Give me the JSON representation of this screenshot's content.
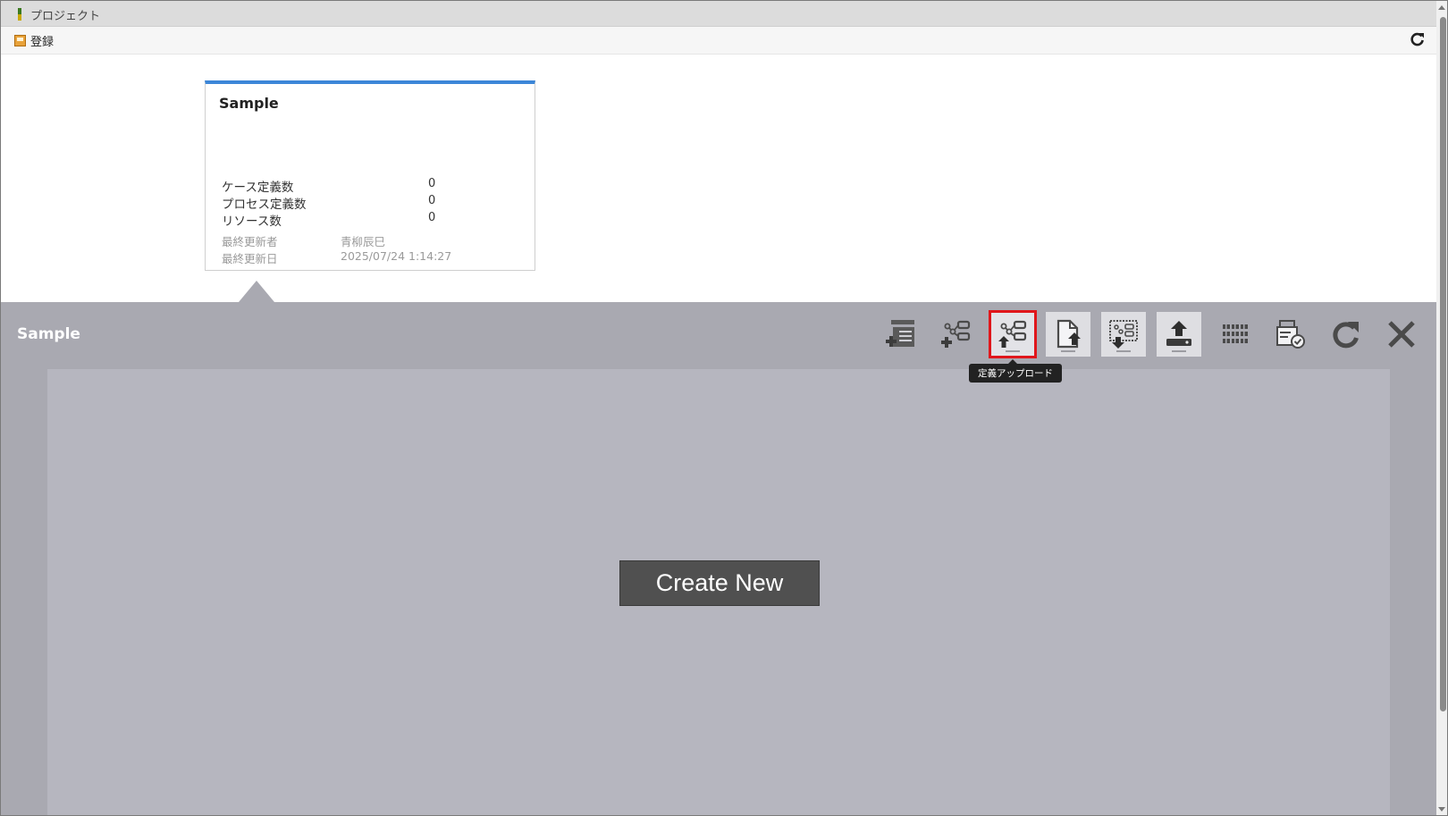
{
  "window": {
    "title": "プロジェクト"
  },
  "toolbar": {
    "register_label": "登録",
    "refresh_icon": "refresh-icon"
  },
  "card": {
    "title": "Sample",
    "stats": [
      {
        "label": "ケース定義数",
        "value": "0"
      },
      {
        "label": "プロセス定義数",
        "value": "0"
      },
      {
        "label": "リソース数",
        "value": "0"
      }
    ],
    "meta": [
      {
        "label": "最終更新者",
        "value": "青柳辰巳"
      },
      {
        "label": "最終更新日",
        "value": "2025/07/24 1:14:27"
      }
    ],
    "accent_color": "#3c86d8"
  },
  "panel": {
    "title": "Sample",
    "create_new_label": "Create New",
    "tooltip": "定義アップロード",
    "buttons": [
      {
        "icon": "add-case-definition-icon"
      },
      {
        "icon": "add-process-definition-icon"
      },
      {
        "icon": "upload-definition-icon",
        "highlighted": true
      },
      {
        "icon": "upload-document-icon"
      },
      {
        "icon": "download-definition-icon"
      },
      {
        "icon": "upload-icon"
      },
      {
        "icon": "grid-icon"
      },
      {
        "icon": "deploy-check-icon"
      },
      {
        "icon": "refresh-icon"
      },
      {
        "icon": "close-icon"
      }
    ],
    "highlight_color": "#e0161b"
  }
}
